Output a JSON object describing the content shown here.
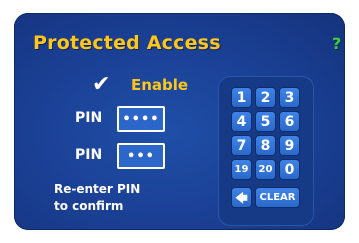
{
  "screen": {
    "title": "Protected Access",
    "help_label": "?"
  },
  "enable": {
    "checked": true,
    "check_glyph": "✔",
    "label": "Enable"
  },
  "pin_fields": [
    {
      "label": "PIN",
      "value": "••••"
    },
    {
      "label": "PIN",
      "value": "•••"
    }
  ],
  "hint": {
    "line1": "Re-enter PIN",
    "line2": "to confirm"
  },
  "keypad": {
    "rows": [
      [
        "1",
        "2",
        "3"
      ],
      [
        "4",
        "5",
        "6"
      ],
      [
        "7",
        "8",
        "9"
      ],
      [
        "19",
        "20",
        "0"
      ]
    ],
    "back_glyph": "🡄",
    "back_icon": "left-arrow-icon",
    "clear_label": "CLEAR"
  },
  "colors": {
    "title": "#ffc61a",
    "help": "#38d13a",
    "panel": "#1a3f93",
    "key": "#3e83e5"
  }
}
